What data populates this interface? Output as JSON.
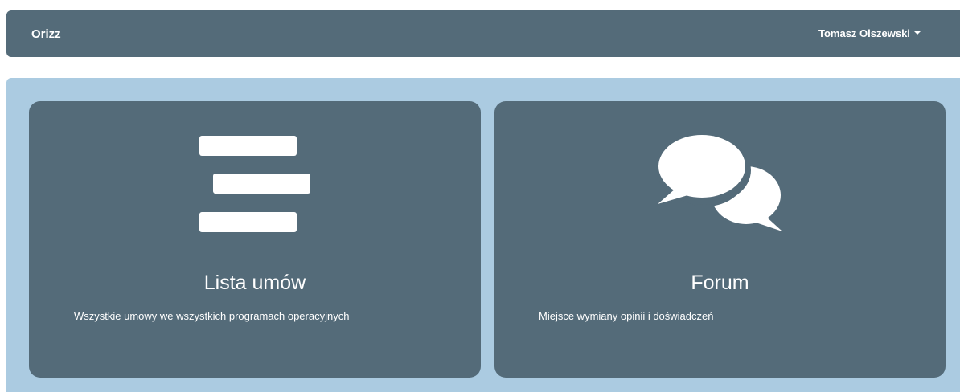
{
  "navbar": {
    "brand": "Orizz",
    "user_name": "Tomasz Olszewski"
  },
  "tiles": [
    {
      "title": "Lista umów",
      "description": "Wszystkie umowy we wszystkich programach operacyjnych",
      "icon": "list-icon"
    },
    {
      "title": "Forum",
      "description": "Miejsce wymiany opinii i doświadczeń",
      "icon": "chat-bubbles-icon"
    }
  ],
  "colors": {
    "navbar_bg": "#546b79",
    "panel_bg": "#abcbe1",
    "tile_bg": "#546b79",
    "text": "#ffffff"
  }
}
